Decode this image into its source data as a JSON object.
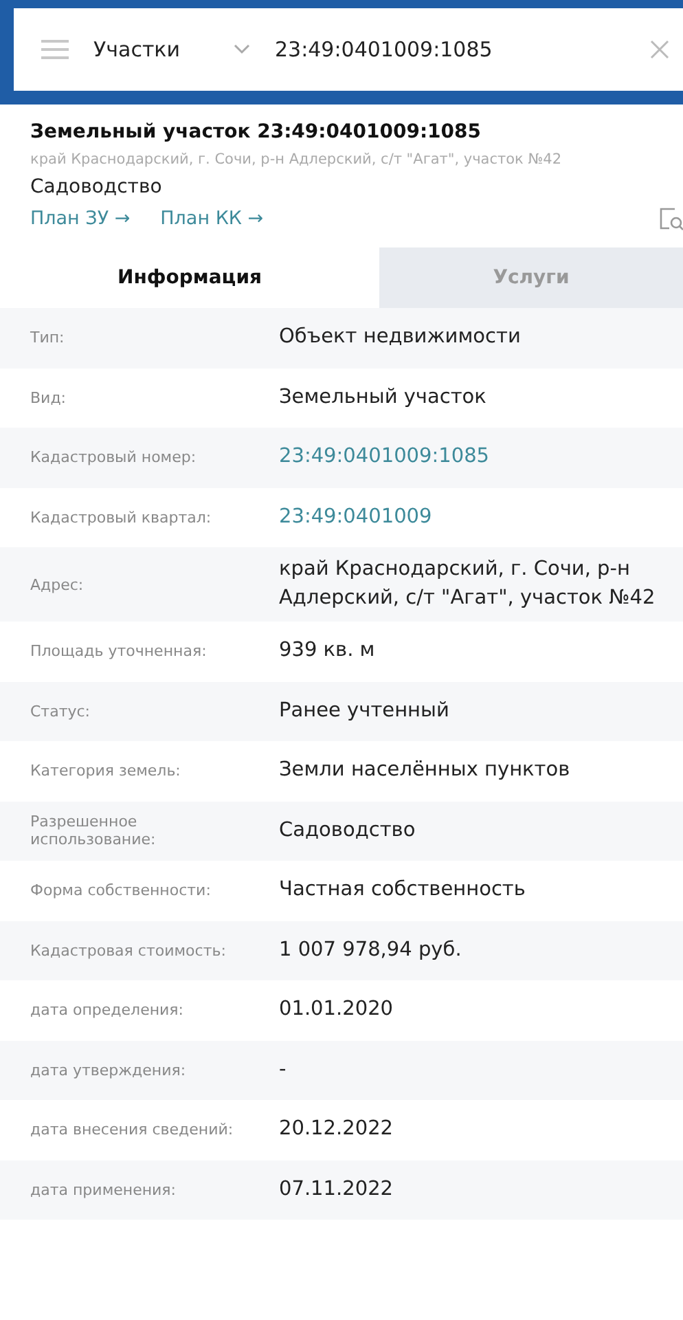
{
  "search_bar": {
    "category": "Участки",
    "query": "23:49:0401009:1085"
  },
  "object": {
    "title": "Земельный участок 23:49:0401009:1085",
    "address": "край Краснодарский, г. Сочи, р-н Адлерский, с/т \"Агат\", участок №42",
    "use": "Садоводство",
    "links": [
      "План ЗУ →",
      "План КК →"
    ]
  },
  "tabs": [
    {
      "label": "Информация",
      "selected": true
    },
    {
      "label": "Услуги",
      "selected": false
    }
  ],
  "rows": [
    {
      "label": "Тип:",
      "value": "Объект недвижимости",
      "kind": "text"
    },
    {
      "label": "Вид:",
      "value": "Земельный участок",
      "kind": "text"
    },
    {
      "label": "Кадастровый номер:",
      "value": "23:49:0401009:1085",
      "kind": "link"
    },
    {
      "label": "Кадастровый квартал:",
      "value": "23:49:0401009",
      "kind": "link"
    },
    {
      "label": "Адрес:",
      "value": "край Краснодарский, г. Сочи, р-н Адлерский, с/т \"Агат\", участок №42",
      "kind": "text"
    },
    {
      "label": "Площадь уточненная:",
      "value": "939 кв. м",
      "kind": "text"
    },
    {
      "label": "Статус:",
      "value": "Ранее учтенный",
      "kind": "text"
    },
    {
      "label": "Категория земель:",
      "value": "Земли населённых пунктов",
      "kind": "text"
    },
    {
      "label": "Разрешенное использование:",
      "value": "Садоводство",
      "kind": "text"
    },
    {
      "label": "Форма собственности:",
      "value": "Частная собственность",
      "kind": "text"
    },
    {
      "label": "Кадастровая стоимость:",
      "value": "1 007 978,94 руб.",
      "kind": "text"
    },
    {
      "label": "дата определения:",
      "value": "01.01.2020",
      "kind": "text"
    },
    {
      "label": "дата утверждения:",
      "value": "-",
      "kind": "text"
    },
    {
      "label": "дата внесения сведений:",
      "value": "20.12.2022",
      "kind": "text"
    },
    {
      "label": "дата применения:",
      "value": "07.11.2022",
      "kind": "text"
    }
  ]
}
